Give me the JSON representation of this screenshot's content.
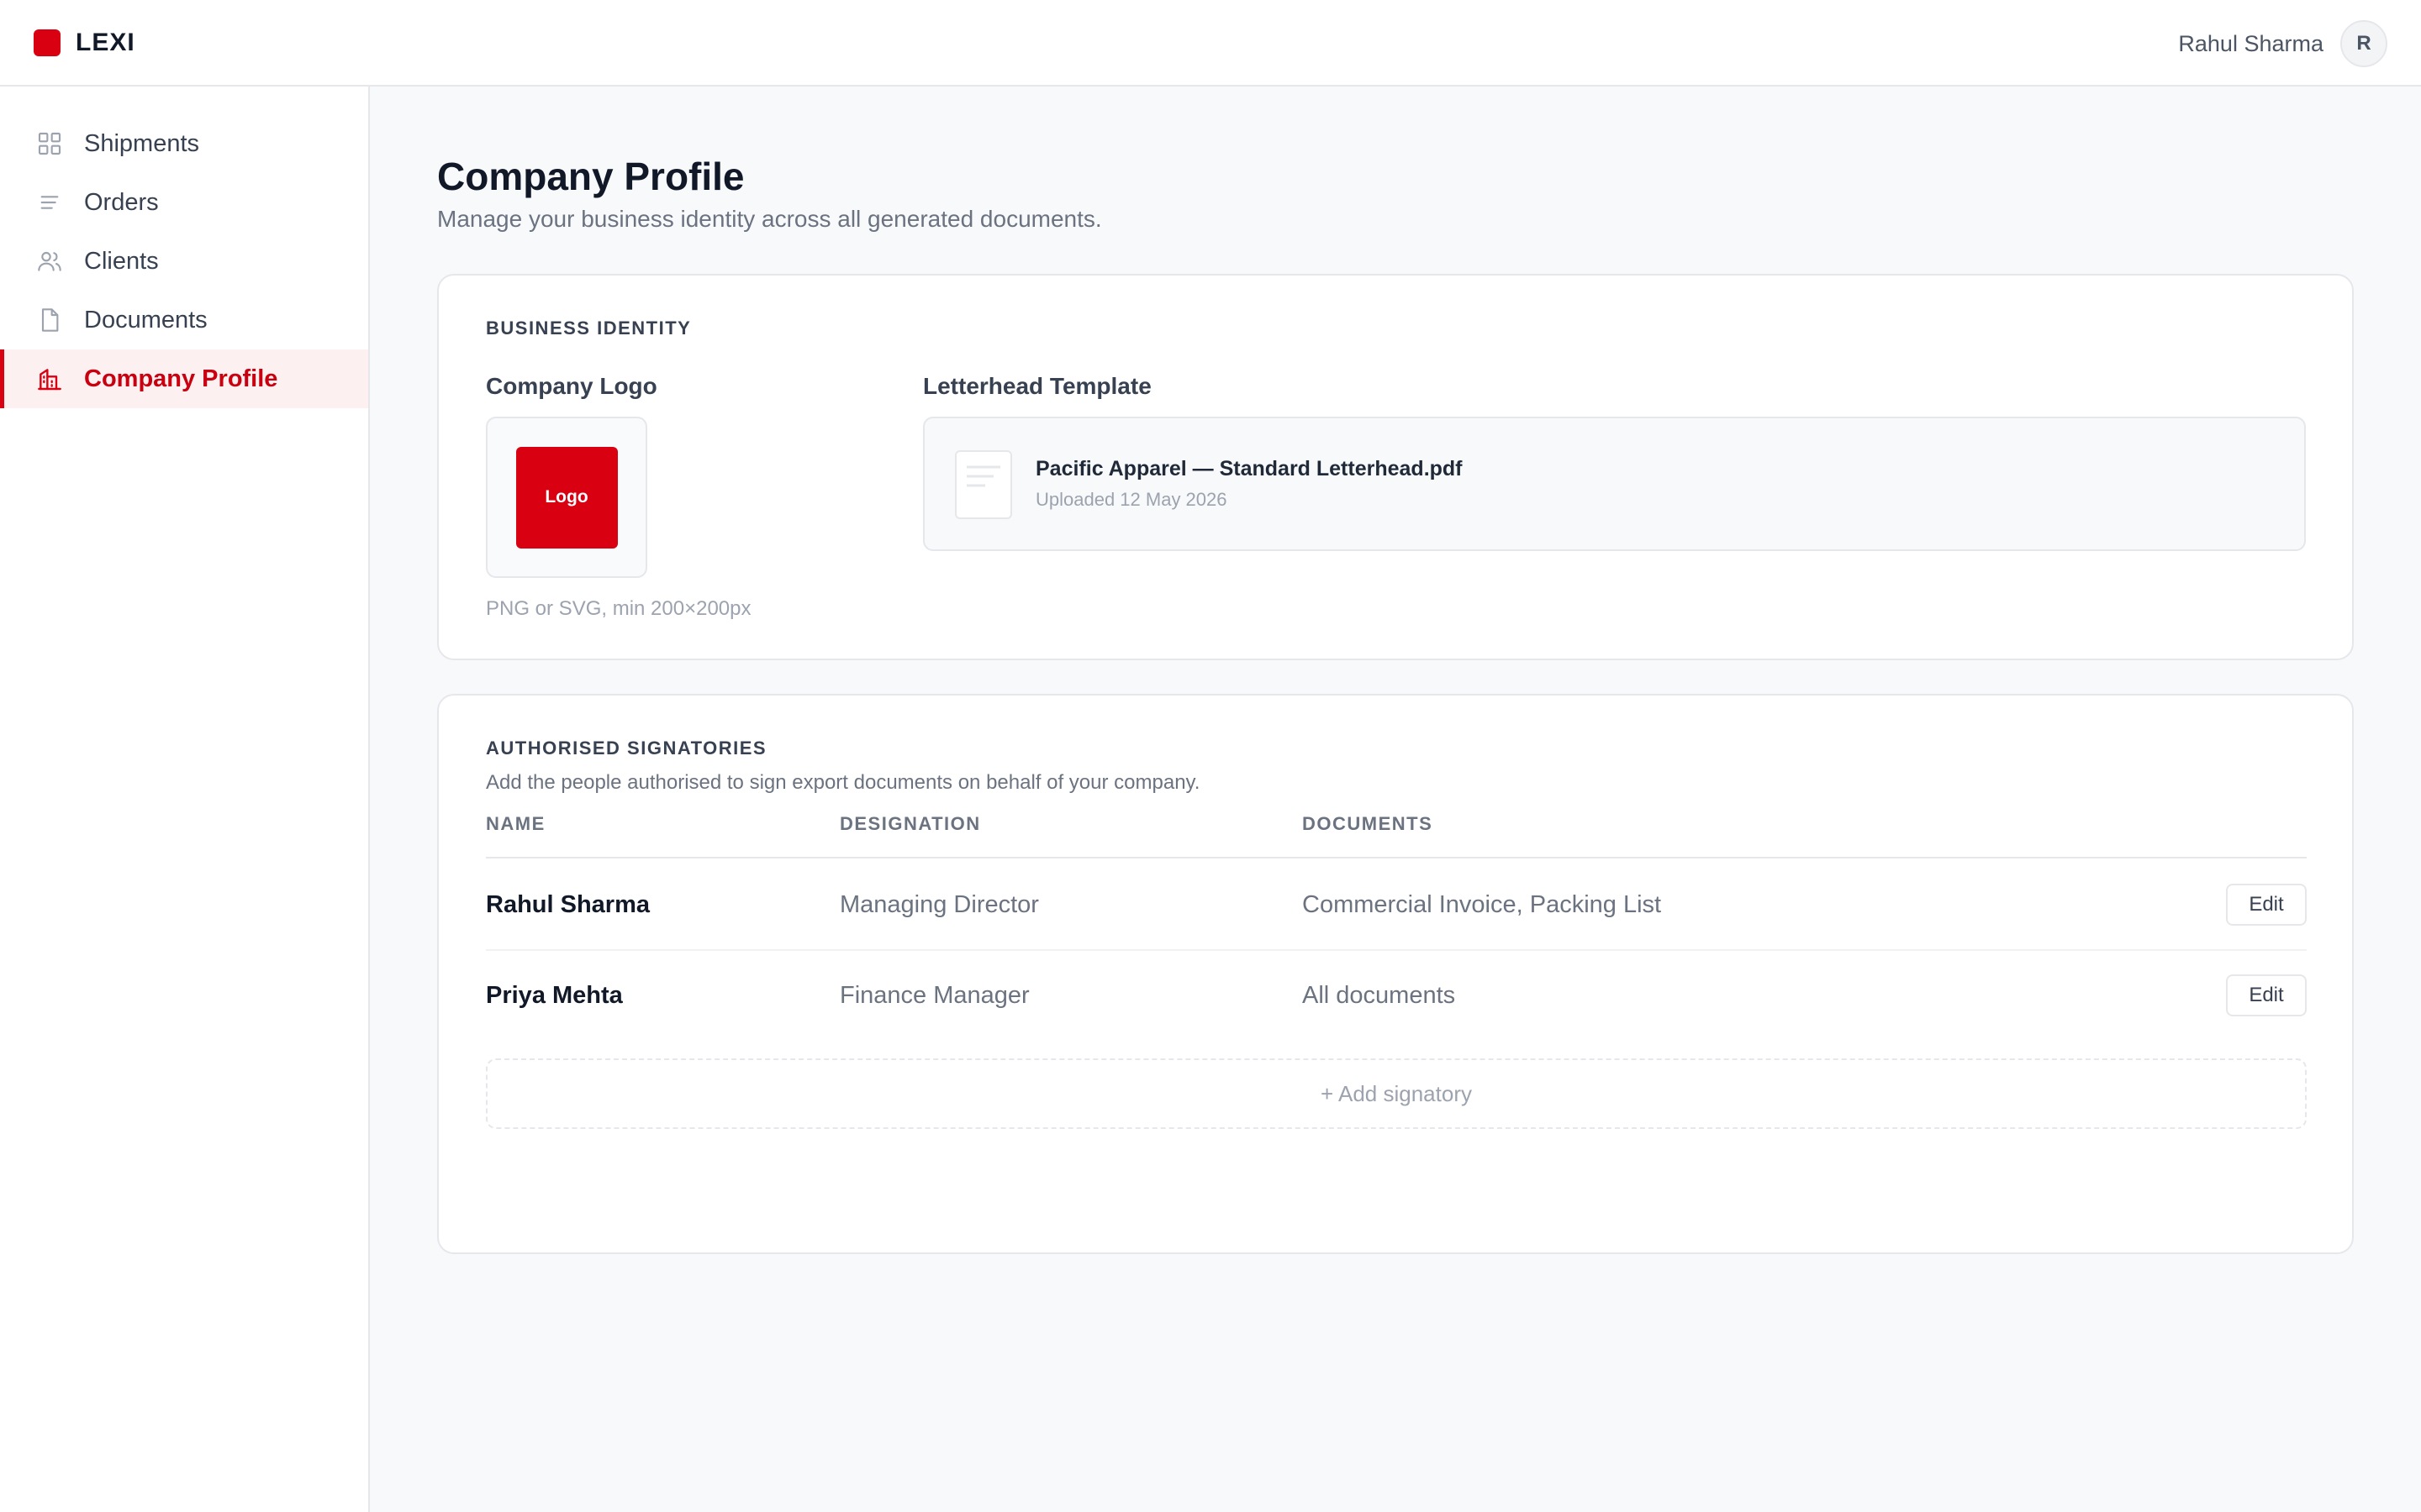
{
  "app": {
    "brand": "LEXI",
    "accent_color": "#d90012"
  },
  "user": {
    "name": "Rahul Sharma",
    "initial": "R"
  },
  "sidebar": {
    "items": [
      {
        "label": "Shipments",
        "icon": "grid-icon",
        "active": false
      },
      {
        "label": "Orders",
        "icon": "list-icon",
        "active": false
      },
      {
        "label": "Clients",
        "icon": "users-icon",
        "active": false
      },
      {
        "label": "Documents",
        "icon": "document-icon",
        "active": false
      },
      {
        "label": "Company Profile",
        "icon": "building-icon",
        "active": true
      }
    ]
  },
  "page": {
    "title": "Company Profile",
    "subtitle": "Manage your business identity across all generated documents."
  },
  "identity": {
    "section_label": "BUSINESS IDENTITY",
    "logo": {
      "label": "Company Logo",
      "placeholder_text": "Logo",
      "hint": "PNG or SVG, min 200×200px"
    },
    "letterhead": {
      "label": "Letterhead Template",
      "file_name": "Pacific Apparel — Standard Letterhead.pdf",
      "uploaded": "Uploaded 12 May 2026"
    }
  },
  "signatories": {
    "section_label": "AUTHORISED SIGNATORIES",
    "description": "Add the people authorised to sign export documents on behalf of your company.",
    "columns": [
      "NAME",
      "DESIGNATION",
      "DOCUMENTS"
    ],
    "rows": [
      {
        "name": "Rahul Sharma",
        "designation": "Managing Director",
        "documents": "Commercial Invoice, Packing List",
        "action": "Edit"
      },
      {
        "name": "Priya Mehta",
        "designation": "Finance Manager",
        "documents": "All documents",
        "action": "Edit"
      }
    ],
    "add_label": "+ Add signatory"
  }
}
